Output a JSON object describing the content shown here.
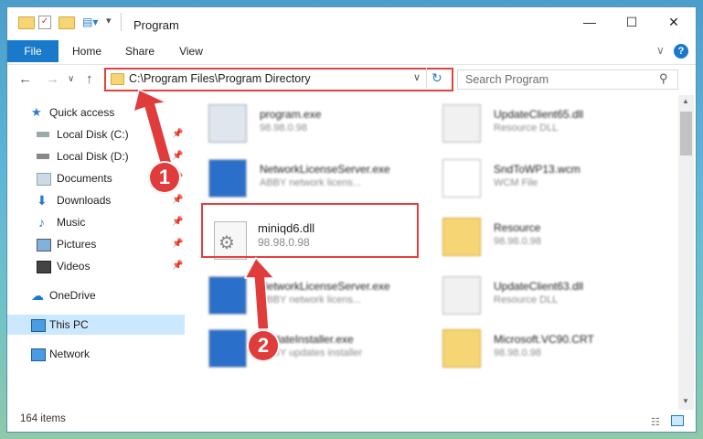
{
  "window": {
    "title": "Program"
  },
  "ribbon": {
    "tabs": [
      "File",
      "Home",
      "Share",
      "View"
    ]
  },
  "address": {
    "path": "C:\\Program Files\\Program Directory",
    "search_placeholder": "Search Program"
  },
  "sidebar": {
    "items": [
      {
        "label": "Quick access",
        "icon": "star-icon"
      },
      {
        "label": "Local Disk (C:)",
        "icon": "drive-icon",
        "pinned": true
      },
      {
        "label": "Local Disk (D:)",
        "icon": "drive-icon",
        "pinned": true
      },
      {
        "label": "Documents",
        "icon": "documents-icon",
        "pinned": true
      },
      {
        "label": "Downloads",
        "icon": "download-icon",
        "pinned": true
      },
      {
        "label": "Music",
        "icon": "music-icon",
        "pinned": true
      },
      {
        "label": "Pictures",
        "icon": "pictures-icon",
        "pinned": true
      },
      {
        "label": "Videos",
        "icon": "videos-icon",
        "pinned": true
      },
      {
        "label": "OneDrive",
        "icon": "cloud-icon"
      },
      {
        "label": "This PC",
        "icon": "pc-icon",
        "selected": true
      },
      {
        "label": "Network",
        "icon": "network-icon"
      }
    ]
  },
  "files": [
    {
      "name": "program.exe",
      "sub": "98.98.0.98"
    },
    {
      "name": "UpdateClient65.dll",
      "sub": "Resource DLL"
    },
    {
      "name": "NetworkLicenseServer.exe",
      "sub": "ABBY network licens..."
    },
    {
      "name": "SndToWP13.wcm",
      "sub": "WCM File"
    },
    {
      "name": "miniqd6.dll",
      "sub": "98.98.0.98"
    },
    {
      "name": "Resource",
      "sub": "98.98.0.98"
    },
    {
      "name": "NetworkLicenseServer.exe",
      "sub": "ABBY network licens..."
    },
    {
      "name": "UpdateClient63.dll",
      "sub": "Resource DLL"
    },
    {
      "name": "UpdateInstaller.exe",
      "sub": "ABBY updates installer"
    },
    {
      "name": "Microsoft.VC90.CRT",
      "sub": "98.98.0.98"
    }
  ],
  "callouts": [
    "1",
    "2"
  ],
  "status": {
    "count": "164 items"
  },
  "colors": {
    "accent": "#1979ca",
    "highlight": "#e34040",
    "selected_bg": "#cce8ff"
  }
}
